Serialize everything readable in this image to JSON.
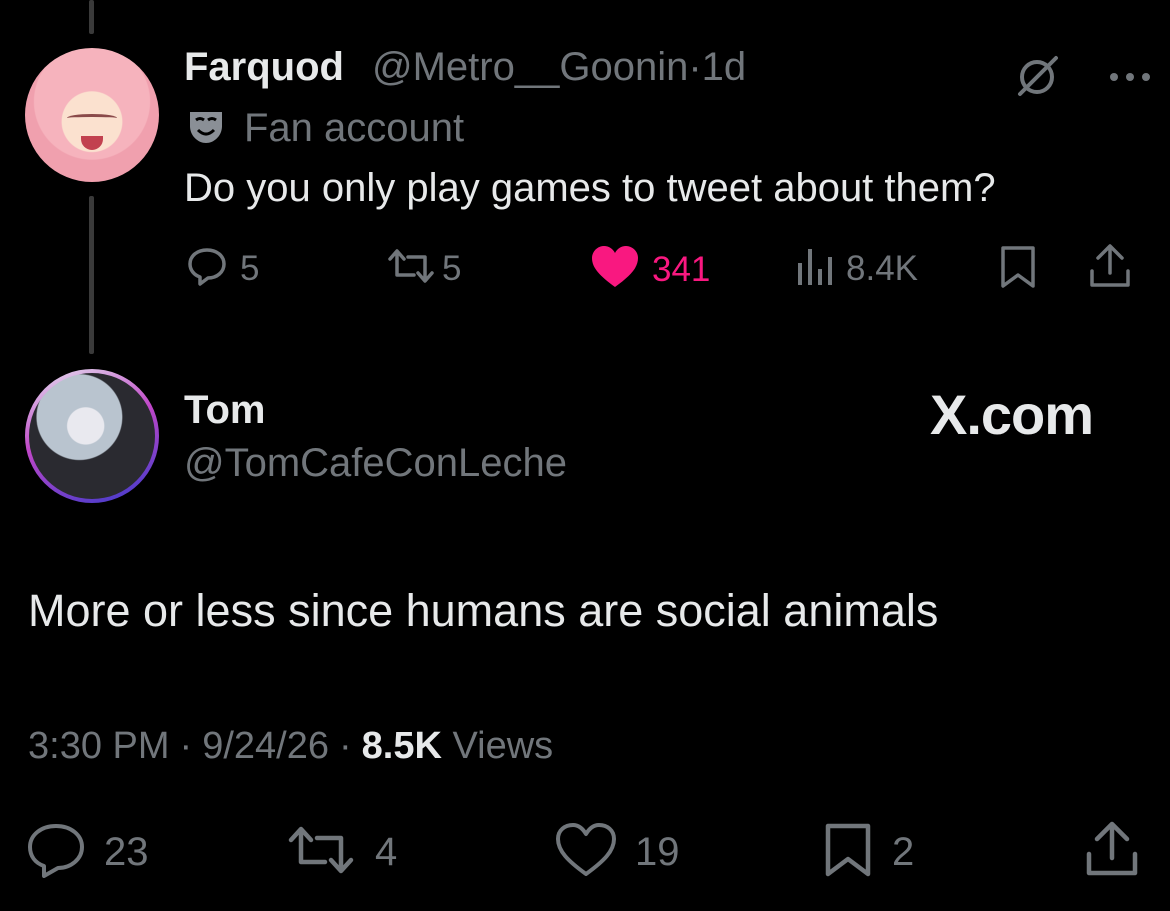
{
  "parent_tweet": {
    "name": "Farquod",
    "handle": "@Metro__Goonin",
    "time": "1d",
    "dot": "·",
    "label": "Fan account",
    "text": "Do you only play games to tweet about them?",
    "replies": "5",
    "reposts": "5",
    "likes": "341",
    "views": "8.4K",
    "like_color": "#f91880",
    "icons": [
      "grok-icon",
      "more-icon",
      "reply-icon",
      "repost-icon",
      "heart-filled-icon",
      "views-icon",
      "bookmark-icon",
      "share-icon",
      "mask-icon"
    ]
  },
  "main_tweet": {
    "name": "Tom",
    "handle": "@TomCafeConLeche",
    "watermark": "X.com",
    "text": "More or less since humans are social animals",
    "time": "3:30 PM",
    "date": "9/24/26",
    "dot": "·",
    "views_count": "8.5K",
    "views_label": "Views",
    "replies": "23",
    "reposts": "4",
    "likes": "19",
    "bookmarks": "2",
    "icons": [
      "reply-icon",
      "repost-icon",
      "heart-icon",
      "bookmark-icon",
      "share-icon"
    ]
  },
  "colors": {
    "background": "#000000",
    "text": "#e7e9ea",
    "muted": "#71767b",
    "like": "#f91880"
  }
}
